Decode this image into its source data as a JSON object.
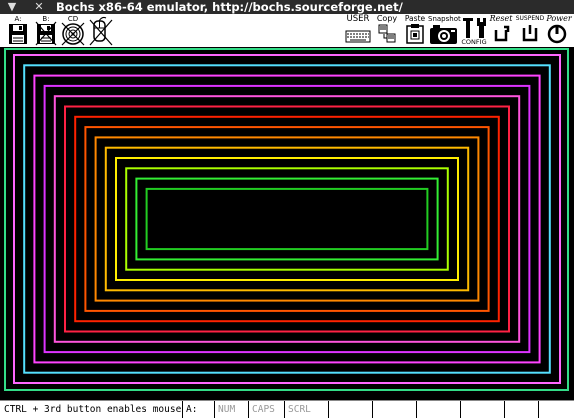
{
  "window": {
    "title": "Bochs x86-64 emulator, http://bochs.sourceforge.net/",
    "menu_glyph": "▼",
    "close_glyph": "✕"
  },
  "toolbar": {
    "floppy_a_label": "A:",
    "floppy_b_label": "B:",
    "cdrom_label": "CD",
    "mouse_label": "",
    "user_label": "USER",
    "copy_label": "Copy",
    "paste_label": "Paste",
    "snapshot_label": "Snapshot",
    "config_label": "CONFIG",
    "reset_label": "Reset",
    "suspend_label": "SUSPEND",
    "power_label": "Power"
  },
  "status": {
    "message": "CTRL + 3rd button enables mouse",
    "drive": "A:",
    "num": "NUM",
    "caps": "CAPS",
    "scrl": "SCRL"
  },
  "screen": {
    "rect_colors": [
      "#ff66ff",
      "#55e0ff",
      "#ff44ff",
      "#dd33ff",
      "#ff55dd",
      "#ff2244",
      "#ff2200",
      "#ff5500",
      "#ff8800",
      "#ffbb00",
      "#ffee00",
      "#aaff00",
      "#33ee33",
      "#22cc22"
    ]
  }
}
